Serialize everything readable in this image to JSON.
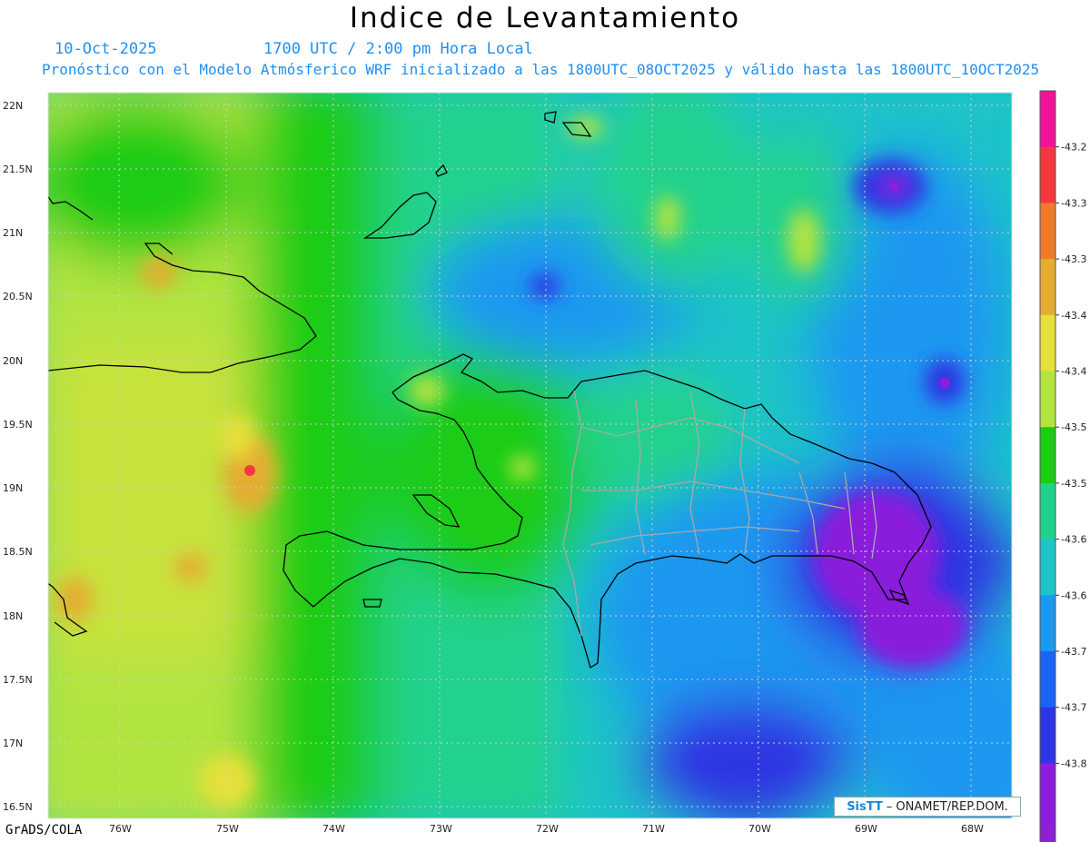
{
  "header": {
    "title": "Indice de Levantamiento",
    "date": "10-Oct-2025",
    "time": "1700 UTC / 2:00 pm Hora Local",
    "model_info": "Pronóstico con el Modelo Atmósferico WRF inicializado a las 1800UTC_08OCT2025 y válido hasta las  1800UTC_10OCT2025"
  },
  "axes": {
    "y_labels": [
      "22N",
      "21.5N",
      "21N",
      "20.5N",
      "20N",
      "19.5N",
      "19N",
      "18.5N",
      "18N",
      "17.5N",
      "17N",
      "16.5N"
    ],
    "x_labels": [
      "76W",
      "75W",
      "74W",
      "73W",
      "72W",
      "71W",
      "70W",
      "69W",
      "68W"
    ]
  },
  "colorbar": {
    "labels": [
      "-43.2",
      "-43.3",
      "-43.3",
      "-43.4",
      "-43.4",
      "-43.5",
      "-43.5",
      "-43.6",
      "-43.6",
      "-43.7",
      "-43.7",
      "-43.8"
    ],
    "colors": [
      "#f0129a",
      "#f2393e",
      "#ef7a29",
      "#e4ad31",
      "#e6e03a",
      "#b2e441",
      "#1ccc12",
      "#20d18d",
      "#1cc3c7",
      "#1b98f0",
      "#1a64f5",
      "#2d36e2",
      "#8a1edc",
      "#8d20d5"
    ]
  },
  "footer": {
    "software": "GrADS/COLA",
    "credit_logo": "SisTT",
    "credit_text": "– ONAMET/REP.DOM."
  }
}
